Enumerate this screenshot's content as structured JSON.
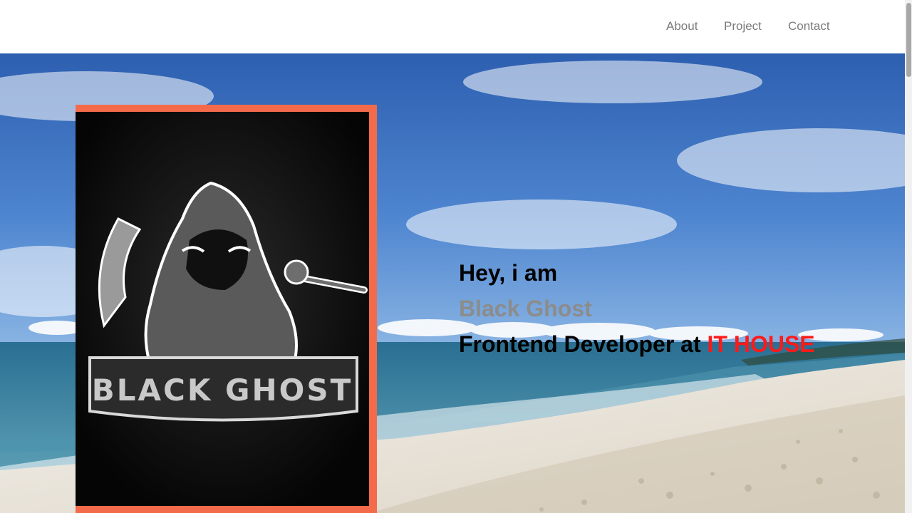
{
  "nav": {
    "items": [
      "About",
      "Project",
      "Contact"
    ]
  },
  "hero": {
    "greeting": "Hey, i am",
    "name": "Black Ghost",
    "role_prefix": "Frontend Developer at ",
    "company": "IT HOUSE"
  },
  "portrait": {
    "alt": "Black Ghost reaper mascot logo",
    "logo_text": "BLACK GHOST"
  },
  "colors": {
    "accent_frame": "#f36b4b",
    "name": "#8c8c8c",
    "company": "#ff1a1a",
    "text": "#000000"
  }
}
